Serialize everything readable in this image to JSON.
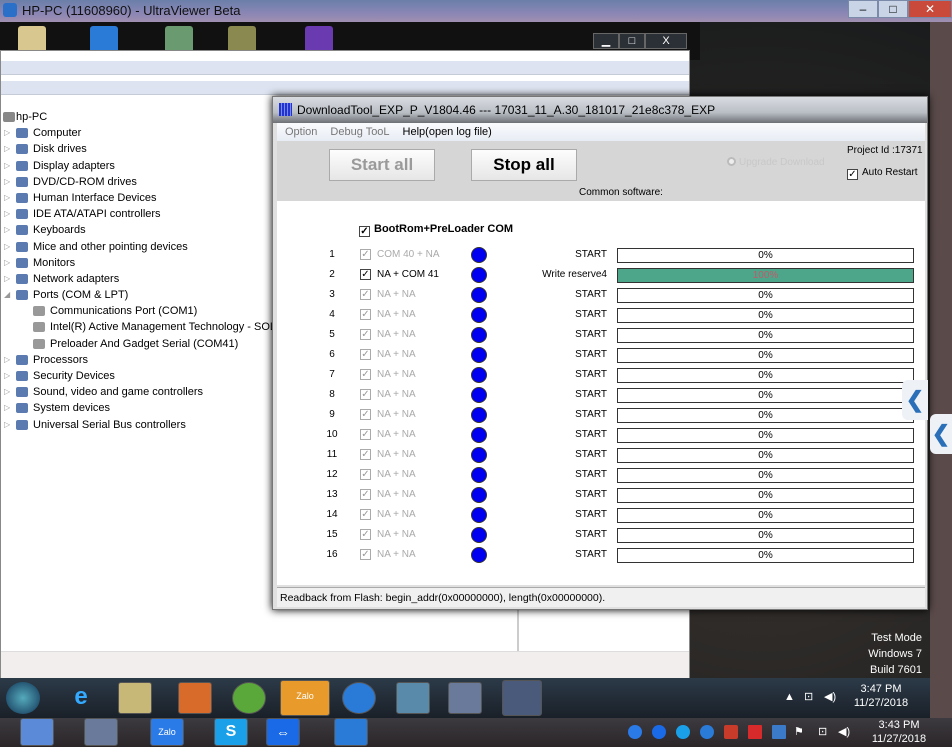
{
  "viewer": {
    "title": "HP-PC (11608960) - UltraViewer Beta"
  },
  "device_manager": {
    "root": "hp-PC",
    "items": [
      {
        "label": "Computer",
        "level": 1
      },
      {
        "label": "Disk drives",
        "level": 1
      },
      {
        "label": "Display adapters",
        "level": 1
      },
      {
        "label": "DVD/CD-ROM drives",
        "level": 1
      },
      {
        "label": "Human Interface Devices",
        "level": 1
      },
      {
        "label": "IDE ATA/ATAPI controllers",
        "level": 1
      },
      {
        "label": "Keyboards",
        "level": 1
      },
      {
        "label": "Mice and other pointing devices",
        "level": 1
      },
      {
        "label": "Monitors",
        "level": 1
      },
      {
        "label": "Network adapters",
        "level": 1
      },
      {
        "label": "Ports (COM & LPT)",
        "level": 1,
        "expanded": true
      },
      {
        "label": "Communications Port (COM1)",
        "level": 2
      },
      {
        "label": "Intel(R) Active Management Technology - SOL",
        "level": 2
      },
      {
        "label": "Preloader And Gadget Serial (COM41)",
        "level": 2
      },
      {
        "label": "Processors",
        "level": 1
      },
      {
        "label": "Security Devices",
        "level": 1
      },
      {
        "label": "Sound, video and game controllers",
        "level": 1
      },
      {
        "label": "System devices",
        "level": 1
      },
      {
        "label": "Universal Serial Bus controllers",
        "level": 1
      }
    ]
  },
  "download_tool": {
    "title": "DownloadTool_EXP_P_V1804.46 --- 17031_11_A.30_181017_21e8c378_EXP",
    "menu": [
      "Option",
      "Debug TooL",
      "Help(open log file)"
    ],
    "start_all": "Start all",
    "stop_all": "Stop all",
    "upgrade_download": "Upgrade Download",
    "project_id": "Project Id :17371",
    "auto_restart": "Auto Restart",
    "common_software": "Common software:",
    "bootrom_label": "BootRom+PreLoader COM",
    "indicator_color": "#0000f0",
    "progress_color": "#4ea68a",
    "rows": [
      {
        "num": "1",
        "port": "COM 40 + NA",
        "enabled": false,
        "status": "START",
        "progress": 0,
        "pct": "0%"
      },
      {
        "num": "2",
        "port": "NA + COM 41",
        "enabled": true,
        "status": "Write reserve4",
        "progress": 100,
        "pct": "100%"
      },
      {
        "num": "3",
        "port": "NA + NA",
        "enabled": false,
        "status": "START",
        "progress": 0,
        "pct": "0%"
      },
      {
        "num": "4",
        "port": "NA + NA",
        "enabled": false,
        "status": "START",
        "progress": 0,
        "pct": "0%"
      },
      {
        "num": "5",
        "port": "NA + NA",
        "enabled": false,
        "status": "START",
        "progress": 0,
        "pct": "0%"
      },
      {
        "num": "6",
        "port": "NA + NA",
        "enabled": false,
        "status": "START",
        "progress": 0,
        "pct": "0%"
      },
      {
        "num": "7",
        "port": "NA + NA",
        "enabled": false,
        "status": "START",
        "progress": 0,
        "pct": "0%"
      },
      {
        "num": "8",
        "port": "NA + NA",
        "enabled": false,
        "status": "START",
        "progress": 0,
        "pct": "0%"
      },
      {
        "num": "9",
        "port": "NA + NA",
        "enabled": false,
        "status": "START",
        "progress": 0,
        "pct": "0%"
      },
      {
        "num": "10",
        "port": "NA + NA",
        "enabled": false,
        "status": "START",
        "progress": 0,
        "pct": "0%"
      },
      {
        "num": "11",
        "port": "NA + NA",
        "enabled": false,
        "status": "START",
        "progress": 0,
        "pct": "0%"
      },
      {
        "num": "12",
        "port": "NA + NA",
        "enabled": false,
        "status": "START",
        "progress": 0,
        "pct": "0%"
      },
      {
        "num": "13",
        "port": "NA + NA",
        "enabled": false,
        "status": "START",
        "progress": 0,
        "pct": "0%"
      },
      {
        "num": "14",
        "port": "NA + NA",
        "enabled": false,
        "status": "START",
        "progress": 0,
        "pct": "0%"
      },
      {
        "num": "15",
        "port": "NA + NA",
        "enabled": false,
        "status": "START",
        "progress": 0,
        "pct": "0%"
      },
      {
        "num": "16",
        "port": "NA + NA",
        "enabled": false,
        "status": "START",
        "progress": 0,
        "pct": "0%"
      }
    ],
    "status_bar": "Readback from Flash:  begin_addr(0x00000000), length(0x00000000)."
  },
  "watermark": [
    "Test Mode",
    "Windows 7",
    "Build 7601"
  ],
  "remote_taskbar": {
    "time": "3:47 PM",
    "date": "11/27/2018",
    "zalo": "Zalo"
  },
  "local_taskbar": {
    "time": "3:43 PM",
    "date": "11/27/2018",
    "zalo": "Zalo",
    "skype": "S"
  }
}
